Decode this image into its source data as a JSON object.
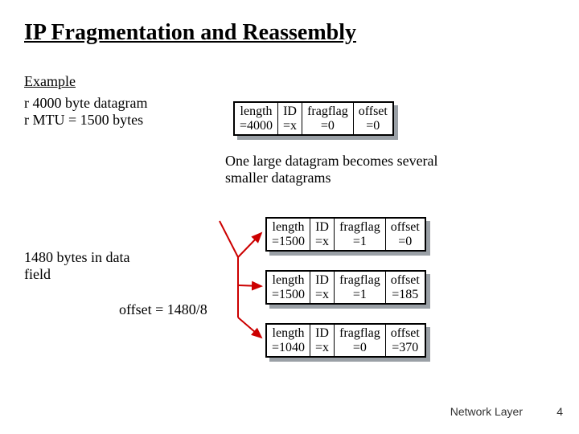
{
  "title": "IP Fragmentation and Reassembly",
  "example_label": "Example",
  "bullets": [
    "4000 byte datagram",
    "MTU = 1500 bytes"
  ],
  "note1": "1480 bytes in data field",
  "note2": "offset = 1480/8",
  "caption": "One large datagram becomes several smaller datagrams",
  "labels": {
    "length": "length",
    "id": "ID",
    "fragflag": "fragflag",
    "offset": "offset"
  },
  "datagrams": {
    "in": {
      "length": "=4000",
      "id": "=x",
      "fragflag": "=0",
      "offset": "=0"
    },
    "out": [
      {
        "length": "=1500",
        "id": "=x",
        "fragflag": "=1",
        "offset": "=0"
      },
      {
        "length": "=1500",
        "id": "=x",
        "fragflag": "=1",
        "offset": "=185"
      },
      {
        "length": "=1040",
        "id": "=x",
        "fragflag": "=0",
        "offset": "=370"
      }
    ]
  },
  "footer": {
    "text": "Network Layer",
    "page": "4"
  },
  "chart_data": {
    "type": "table",
    "title": "IP Fragmentation example: 4000-byte datagram, MTU=1500",
    "columns": [
      "length",
      "ID",
      "fragflag",
      "offset"
    ],
    "rows": [
      [
        "4000",
        "x",
        0,
        0
      ],
      [
        "1500",
        "x",
        1,
        0
      ],
      [
        "1500",
        "x",
        1,
        185
      ],
      [
        "1040",
        "x",
        0,
        370
      ]
    ],
    "notes": [
      "1480 bytes in data field",
      "offset = 1480/8"
    ]
  }
}
